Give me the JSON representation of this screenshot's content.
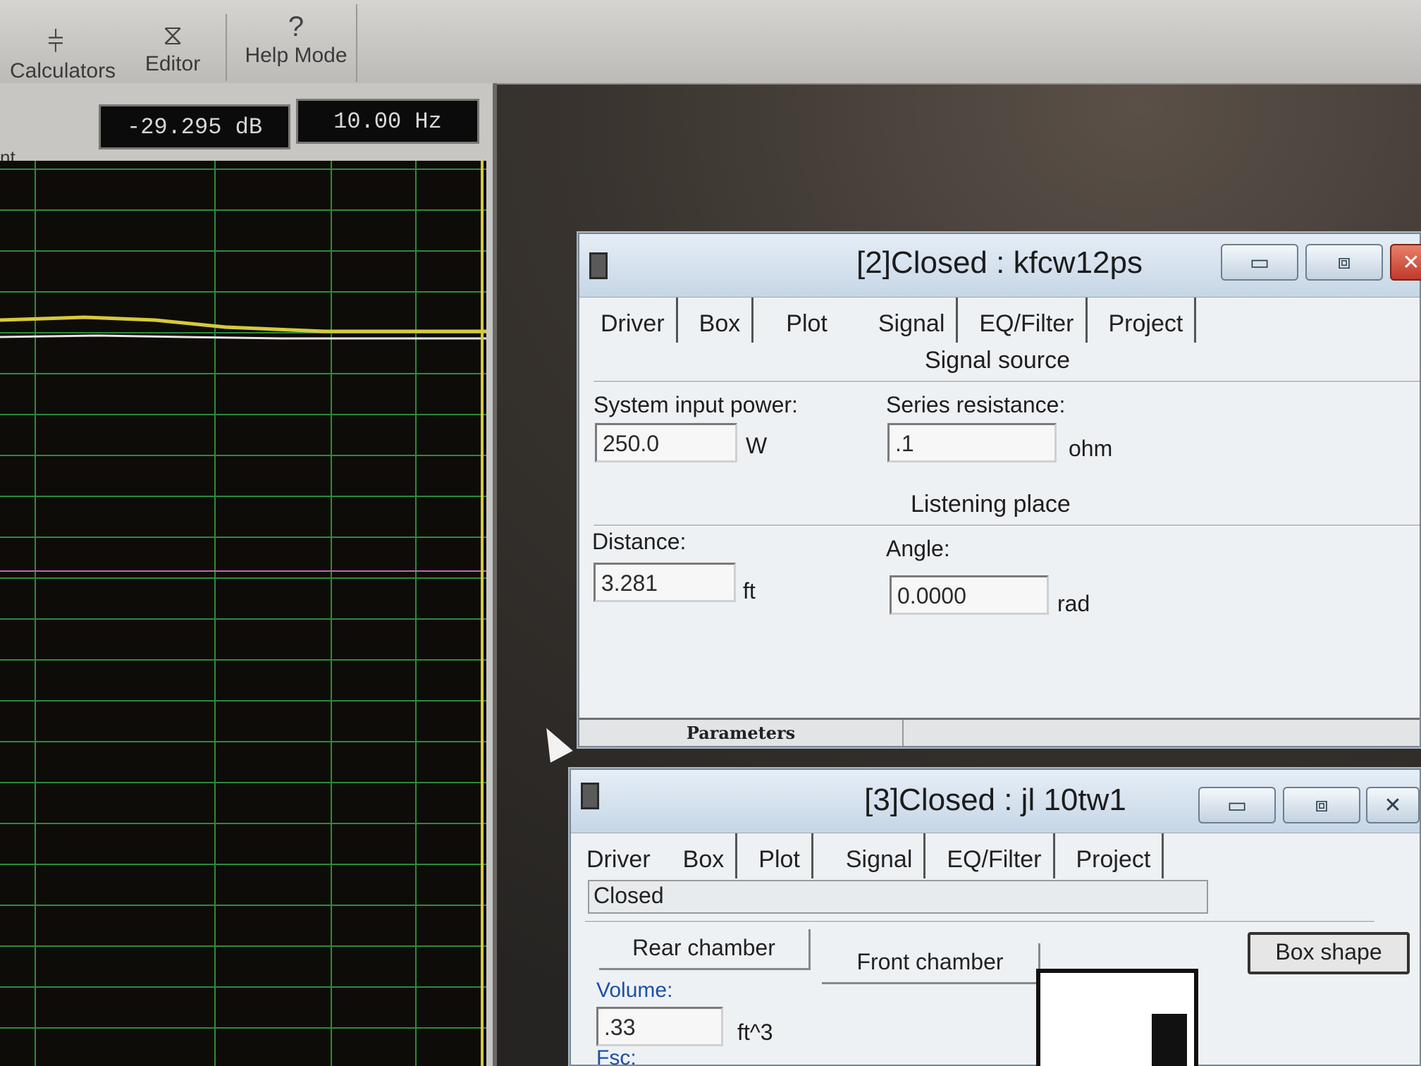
{
  "toolbar": {
    "items": [
      {
        "label": "Calculators",
        "icon": "calculator-icon",
        "glyph": "⫩"
      },
      {
        "label": "Editor",
        "icon": "editor-icon",
        "glyph": "⧖"
      },
      {
        "label": "Help Mode",
        "icon": "help-icon",
        "glyph": "?"
      }
    ]
  },
  "graph": {
    "readout_level": "-29.295 dB",
    "readout_freq": "10.00 Hz",
    "side_label": "nt",
    "colors": {
      "grid": "#2e8a3a",
      "trace_main": "#d8c93a",
      "trace_alt": "#e6e6e6",
      "trace_pink": "#c06ab0"
    }
  },
  "window2": {
    "title": "[2]Closed : kfcw12ps",
    "buttons": {
      "minimize": "▭",
      "maximize": "⧈",
      "close": "✕"
    },
    "tabs": [
      "Driver",
      "Box",
      "Plot",
      "Signal",
      "EQ/Filter",
      "Project"
    ],
    "active_tab": "Signal",
    "signal_source": {
      "heading": "Signal source",
      "power_label": "System input power:",
      "power_value": "250.0",
      "power_unit": "W",
      "resistance_label": "Series resistance:",
      "resistance_value": ".1",
      "resistance_unit": "ohm"
    },
    "listening_place": {
      "heading": "Listening place",
      "distance_label": "Distance:",
      "distance_value": "3.281",
      "distance_unit": "ft",
      "angle_label": "Angle:",
      "angle_value": "0.0000",
      "angle_unit": "rad"
    },
    "status": "Parameters"
  },
  "window3": {
    "title": "[3]Closed : jl 10tw1",
    "buttons": {
      "minimize": "▭",
      "maximize": "⧈",
      "close": "✕"
    },
    "tabs": [
      "Driver",
      "Box",
      "Plot",
      "Signal",
      "EQ/Filter",
      "Project"
    ],
    "active_tab": "Box",
    "box_type": "Closed",
    "rear_chamber": "Rear chamber",
    "front_chamber": "Front chamber",
    "box_shape_button": "Box shape",
    "volume_label": "Volume:",
    "volume_value": ".33",
    "volume_unit": "ft^3",
    "fsc_label": "Fsc:"
  }
}
